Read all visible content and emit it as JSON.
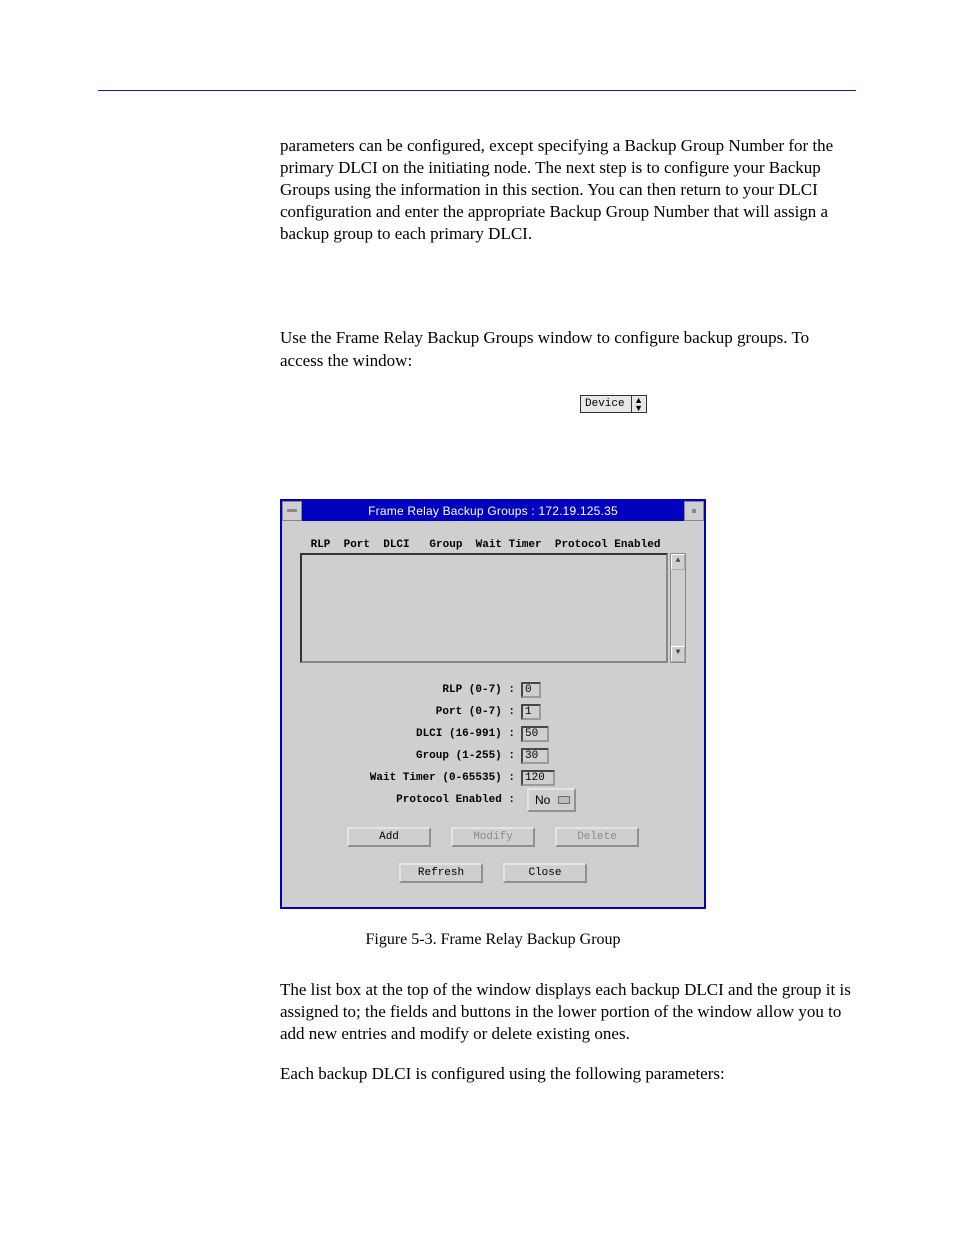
{
  "paragraphs": {
    "p1": "parameters can be configured, except specifying a Backup Group Number for the primary DLCI on the initiating node. The next step is to configure your Backup Groups using the information in this section. You can then return to your DLCI configuration and enter the appropriate Backup Group Number that will assign a backup group to each primary DLCI.",
    "p2": "Use the Frame Relay Backup Groups window to configure backup groups. To access the window:",
    "p3": "The list box at the top of the window displays each backup DLCI and the group it is assigned to; the fields and buttons in the lower portion of the window allow you to add new entries and modify or delete existing ones.",
    "p4": "Each backup DLCI is configured using the following parameters:"
  },
  "device_button": {
    "label": "Device"
  },
  "window": {
    "title": "Frame Relay Backup Groups : 172.19.125.35",
    "columns_line": " RLP  Port  DLCI   Group  Wait Timer  Protocol Enabled",
    "fields": {
      "rlp": {
        "label": "RLP (0-7) :",
        "value": "0"
      },
      "port": {
        "label": "Port (0-7) :",
        "value": "1"
      },
      "dlci": {
        "label": "DLCI (16-991) :",
        "value": "50"
      },
      "group": {
        "label": "Group (1-255) :",
        "value": "30"
      },
      "wait_timer": {
        "label": "Wait Timer (0-65535) :",
        "value": "120"
      },
      "proto": {
        "label": "Protocol Enabled :",
        "value": "No"
      }
    },
    "buttons": {
      "add": "Add",
      "modify": "Modify",
      "delete": "Delete",
      "refresh": "Refresh",
      "close": "Close"
    }
  },
  "figure_caption": "Figure 5-3.  Frame Relay Backup Group"
}
